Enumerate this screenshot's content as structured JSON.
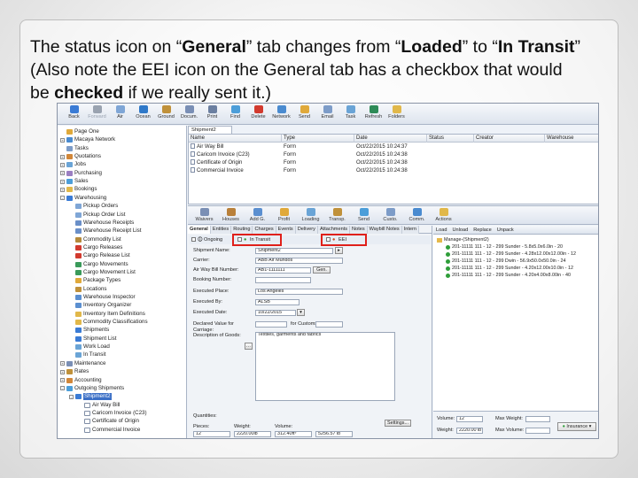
{
  "caption": {
    "line1_a": "The status icon on “",
    "line1_b": "General",
    "line1_c": "” tab changes from “",
    "line1_d": "Loaded",
    "line1_e": "” to “",
    "line1_f": "In Transit",
    "line1_g": "”",
    "line2": "(Also note the EEI icon on the General tab has a checkbox that would",
    "line3_a": "be ",
    "line3_b": "checked",
    "line3_c": " if we really sent it.)"
  },
  "toolbar": {
    "buttons": [
      "Back",
      "Forward",
      "Air",
      "Ocean",
      "Ground",
      "Docum.",
      "Print",
      "Find",
      "Delete",
      "Network",
      "Send",
      "Email",
      "Task",
      "Refresh",
      "Folders"
    ]
  },
  "tree": {
    "items": [
      "Page One",
      "Macaya Network",
      "Tasks",
      "Quotations",
      "Jobs",
      "Purchasing",
      "Sales",
      "Bookings",
      "Warehousing",
      "Pickup Orders",
      "Pickup Order List",
      "Warehouse Receipts",
      "Warehouse Receipt List",
      "Commodity List",
      "Cargo Releases",
      "Cargo Release List",
      "Cargo Movements",
      "Cargo Movement List",
      "Package Types",
      "Locations",
      "Warehouse Inspector",
      "Inventory Organizer",
      "Inventory Item Definitions",
      "Commodity Classifications",
      "Shipments",
      "Shipment List",
      "Work Load",
      "In Transit",
      "Maintenance",
      "Rates",
      "Accounting",
      "Outgoing Shipments",
      "Shipment2",
      "Air Way Bill",
      "Caricom Invoice (C23)",
      "Certificate of Origin",
      "Commercial Invoice"
    ]
  },
  "doc_tab": "Shipment2",
  "grid": {
    "headers": [
      "Name",
      "Type",
      "Date",
      "Status",
      "Creator",
      "Warehouse"
    ],
    "rows": [
      {
        "name": "Air Way Bill",
        "type": "Form",
        "date": "Oct/22/2015 10:24:37"
      },
      {
        "name": "Caricom Invoice (C23)",
        "type": "Form",
        "date": "Oct/22/2015 10:24:38"
      },
      {
        "name": "Certificate of Origin",
        "type": "Form",
        "date": "Oct/22/2015 10:24:38"
      },
      {
        "name": "Commercial Invoice",
        "type": "Form",
        "date": "Oct/22/2015 10:24:38"
      }
    ]
  },
  "toolbar2": {
    "buttons": [
      "Waivers",
      "Houses",
      "Add G.",
      "Profit",
      "Loading",
      "Transp.",
      "Send",
      "Custo.",
      "Comm.",
      "Actions"
    ]
  },
  "form": {
    "tabs": [
      "General",
      "Entities",
      "Routing",
      "Charges",
      "Events",
      "Delivery",
      "Attachments",
      "Notes",
      "Waybill Notes",
      "Intern"
    ],
    "ongoing_label": "Ongoing",
    "in_transit_label": "In Transit",
    "eei_label": "EEI",
    "fields": [
      {
        "label": "Shipment Name:",
        "value": "Shipment2"
      },
      {
        "label": "Carrier:",
        "value": "ABB Air Mundos"
      },
      {
        "label": "Air Way Bill Number:",
        "value": "AB1-1111111"
      },
      {
        "label": "Booking Number:",
        "value": ""
      },
      {
        "label": "Executed Place:",
        "value": "Los Angeles"
      },
      {
        "label": "Executed By:",
        "value": "ALSB"
      },
      {
        "label": "Executed Date:",
        "value": "10/22/2015"
      },
      {
        "label": "Declared Value for Carriage:",
        "value": ""
      },
      {
        "label": "Description of Goods:",
        "value": "Textiles, garments and fabrics"
      }
    ],
    "customs_label": "for Customs",
    "gen_button": "Gen.",
    "settings_button": "Settings...",
    "quantities_label": "Quantities:",
    "pieces_label": "Pieces:",
    "weight_label": "Weight:",
    "volume_label": "Volume:",
    "pieces_value": "12",
    "weight_value": "2220.00lb",
    "volume_value": "312.40ft³",
    "volume2_value": "5256.57 lb"
  },
  "treepanel": {
    "buttons": [
      "Load",
      "Unload",
      "Replace",
      "Unpack"
    ],
    "root": "Manage-(Shipment2)",
    "items": [
      "201-11111 111 - 12 - 299 Sunder - 5.8x5.0x6.0in - 20",
      "201-11111 111 - 12 - 299 Sunder - 4.28x12.00x12.00in - 12",
      "201-11111 111 - 12 - 299 Dwin - 56.9x50.0x50.0in - 24",
      "201-11111 111 - 12 - 299 Sunder - 4.20x12.00x10.0in - 12",
      "201-11111 111 - 12 - 299 Sunder - 4.20x4.00x8.00in - 40"
    ],
    "volume_label": "Volume:",
    "volume_value": "12",
    "weight_label": "Weight:",
    "weight_value": "2220.00 lb",
    "max_weight_label": "Max Weight:",
    "max_volume_label": "Max Volume:",
    "insurance_label": "Insurance"
  },
  "colors": {
    "highlight": "#e0201a",
    "status_green": "#2f9e3a",
    "selection": "#3b6fc6"
  }
}
